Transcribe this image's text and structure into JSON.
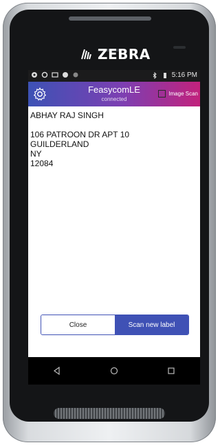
{
  "device": {
    "brand": "ZEBRA"
  },
  "status_bar": {
    "time": "5:16 PM"
  },
  "app_bar": {
    "title": "FeasycomLE",
    "subtitle": "connected",
    "image_scan_label": "Image Scan",
    "image_scan_checked": false
  },
  "label": {
    "name": "ABHAY RAJ SINGH",
    "address_line": "106 PATROON DR APT 10",
    "city": "GUILDERLAND",
    "state": "NY",
    "zip": "12084"
  },
  "actions": {
    "close_label": "Close",
    "scan_label": "Scan new label"
  },
  "colors": {
    "accent": "#3f51b5",
    "gradient_start": "#3d52b5",
    "gradient_end": "#c2227c"
  },
  "icons": [
    "settings-gear-icon",
    "bluetooth-icon",
    "battery-icon",
    "back-icon",
    "home-icon",
    "recents-icon"
  ]
}
